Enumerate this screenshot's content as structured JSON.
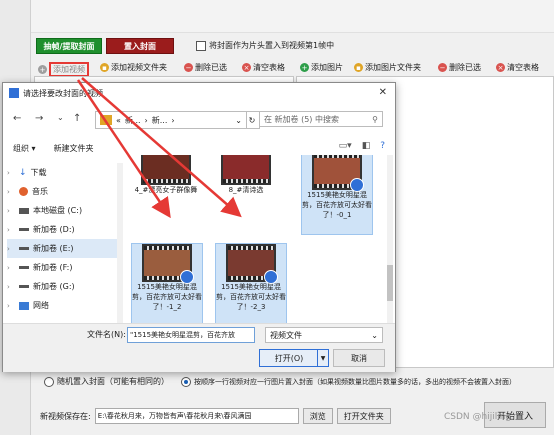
{
  "app": {
    "btn_extract": "抽帧/提取封面",
    "btn_insert": "置入封面",
    "chk_first_frame": "将封面作为片头置入到视频第1帧中",
    "toolbar_left": [
      "添加视频",
      "添加视频文件夹",
      "删除已选",
      "清空表格"
    ],
    "toolbar_right": [
      "添加图片",
      "添加图片文件夹",
      "删除已选",
      "清空表格"
    ],
    "radio_random": "随机置入封面（可能有相同的）",
    "radio_sequence": "按顺序一行视频对应一行图片置入封面（如果视频数量比图片数量多的话，多出的视频不会被置入封面）",
    "save_label": "新视频保存在:",
    "save_path": "E:\\春花秋月来，万物皆有声\\春花秋月来\\春风满园",
    "browse": "浏览",
    "open_folder": "打开文件夹",
    "start": "开始置入",
    "watermark": "CSDN @hijiling",
    "colors": {
      "green": "#1f8f2d",
      "red": "#9b1c1c",
      "accent": "#2f6fd6",
      "arrow": "#e53935"
    }
  },
  "dialog": {
    "title": "请选择要改封面的视频",
    "address": [
      "«",
      "新...",
      "新..."
    ],
    "search_placeholder": "在 新加卷 (5) 中搜索",
    "organize": "组织 ▾",
    "new_folder": "新建文件夹",
    "tree": [
      {
        "label": "下载",
        "icon": "download-icon"
      },
      {
        "label": "音乐",
        "icon": "music-icon"
      },
      {
        "label": "本地磁盘 (C:)",
        "icon": "drive-icon"
      },
      {
        "label": "新加卷 (D:)",
        "icon": "drive-icon"
      },
      {
        "label": "新加卷 (E:)",
        "icon": "drive-icon",
        "selected": true
      },
      {
        "label": "新加卷 (F:)",
        "icon": "drive-icon"
      },
      {
        "label": "新加卷 (G:)",
        "icon": "drive-icon"
      },
      {
        "label": "网络",
        "icon": "network-icon"
      }
    ],
    "files": [
      {
        "name": "4_#漂亮女子群像舞",
        "selected": false
      },
      {
        "name": "8_#清诗选",
        "selected": false
      },
      {
        "name": "1515美艳女明星混剪，百花齐放可太好看了！-0_1",
        "selected": true
      },
      {
        "name": "1515美艳女明星混剪，百花齐放可太好看了！-1_2",
        "selected": true
      },
      {
        "name": "1515美艳女明星混剪，百花齐放可太好看了！-2_3",
        "selected": true
      }
    ],
    "filename_label": "文件名(N):",
    "filename_value": "\"1515美艳女明星混剪，百花齐放",
    "filetype": "视频文件",
    "open": "打开(O)",
    "cancel": "取消"
  }
}
